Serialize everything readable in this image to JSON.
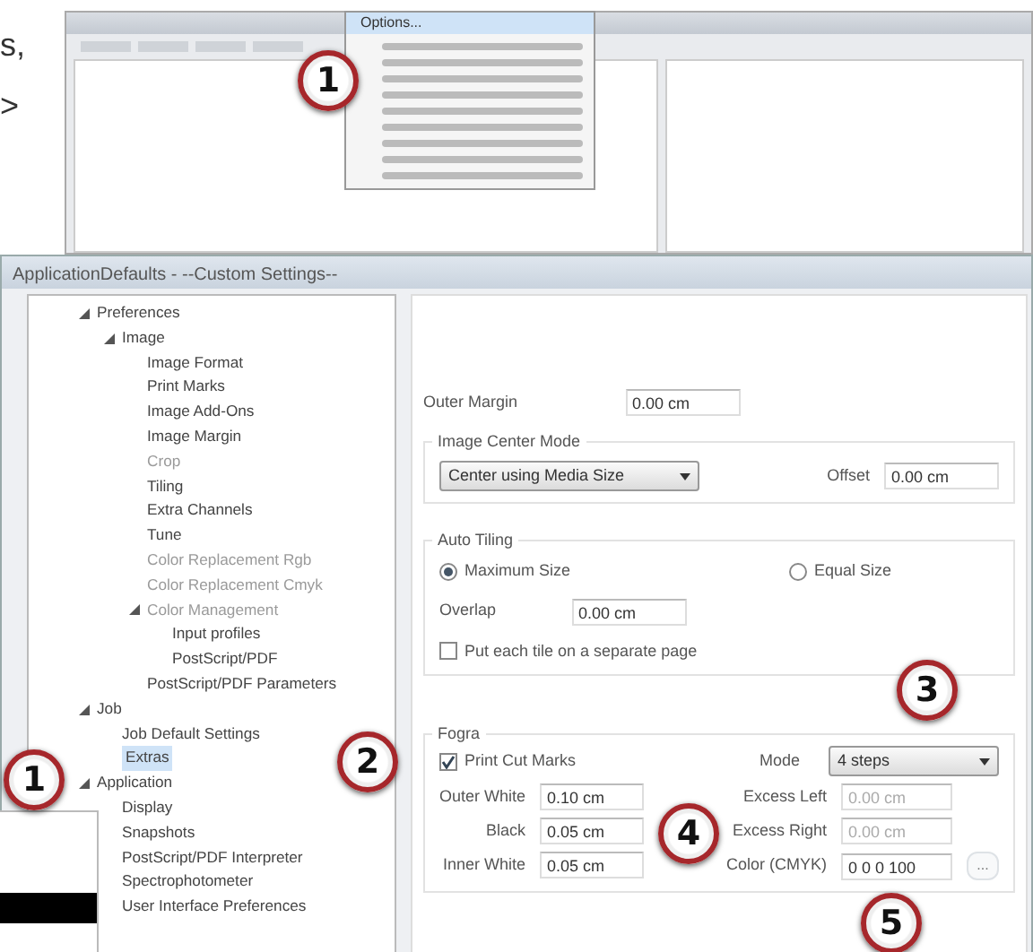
{
  "page_fragments": [
    "s,",
    ">"
  ],
  "background_window": {
    "menu": {
      "first_item": "Options..."
    },
    "callout": "1"
  },
  "dialog": {
    "title": "ApplicationDefaults - --Custom Settings--",
    "tree": [
      {
        "label": "Preferences",
        "expanded": true,
        "selected": false,
        "disabled": false,
        "children": [
          {
            "label": "Image",
            "expanded": true,
            "selected": false,
            "disabled": false,
            "children": [
              {
                "label": "Image Format",
                "selected": false,
                "disabled": false
              },
              {
                "label": "Print Marks",
                "selected": false,
                "disabled": false
              },
              {
                "label": "Image Add-Ons",
                "selected": false,
                "disabled": false
              },
              {
                "label": "Image Margin",
                "selected": false,
                "disabled": false
              },
              {
                "label": "Crop",
                "selected": false,
                "disabled": true
              },
              {
                "label": "Tiling",
                "selected": false,
                "disabled": false
              },
              {
                "label": "Extra Channels",
                "selected": false,
                "disabled": false
              },
              {
                "label": "Tune",
                "selected": false,
                "disabled": false
              },
              {
                "label": "Color Replacement Rgb",
                "selected": false,
                "disabled": true
              },
              {
                "label": "Color Replacement Cmyk",
                "selected": false,
                "disabled": true
              },
              {
                "label": "Color Management",
                "expanded": true,
                "selected": false,
                "disabled": true,
                "children": [
                  {
                    "label": "Input profiles",
                    "selected": false,
                    "disabled": false
                  },
                  {
                    "label": "PostScript/PDF",
                    "selected": false,
                    "disabled": false
                  }
                ]
              },
              {
                "label": "PostScript/PDF Parameters",
                "selected": false,
                "disabled": false
              }
            ]
          }
        ]
      },
      {
        "label": "Job",
        "expanded": true,
        "selected": false,
        "disabled": false,
        "children": [
          {
            "label": "Job Default Settings",
            "selected": false,
            "disabled": false
          },
          {
            "label": "Extras",
            "selected": true,
            "disabled": false
          }
        ]
      },
      {
        "label": "Application",
        "expanded": true,
        "selected": false,
        "disabled": false,
        "children": [
          {
            "label": "Display",
            "selected": false,
            "disabled": false
          },
          {
            "label": "Snapshots",
            "selected": false,
            "disabled": false
          },
          {
            "label": "PostScript/PDF Interpreter",
            "selected": false,
            "disabled": false
          },
          {
            "label": "Spectrophotometer",
            "selected": false,
            "disabled": false
          },
          {
            "label": "User Interface Preferences",
            "selected": false,
            "disabled": false
          }
        ]
      }
    ],
    "outer_margin": {
      "label": "Outer Margin",
      "value": "0.00 cm"
    },
    "image_center_mode": {
      "title": "Image Center Mode",
      "select": "Center using Media Size",
      "offset_label": "Offset",
      "offset": "0.00 cm"
    },
    "auto_tiling": {
      "title": "Auto Tiling",
      "options": [
        {
          "label": "Maximum Size",
          "selected": true
        },
        {
          "label": "Equal Size",
          "selected": false
        }
      ],
      "overlap_label": "Overlap",
      "overlap": "0.00 cm",
      "separate_page": {
        "label": "Put each tile on a separate page",
        "checked": false
      }
    },
    "fogra": {
      "title": "Fogra",
      "print_marks": {
        "label": "Print Cut Marks",
        "checked": true
      },
      "mode_label": "Mode",
      "mode": "4 steps",
      "left_fields": [
        {
          "label": "Outer White",
          "value": "0.10 cm"
        },
        {
          "label": "Black",
          "value": "0.05 cm"
        },
        {
          "label": "Inner White",
          "value": "0.05 cm"
        }
      ],
      "right_fields": [
        {
          "label": "Excess Left",
          "value": "0.00 cm",
          "disabled": true
        },
        {
          "label": "Excess Right",
          "value": "0.00 cm",
          "disabled": true
        },
        {
          "label": "Color (CMYK)",
          "value": "0 0 0 100",
          "disabled": false
        }
      ],
      "color_button": "..."
    }
  },
  "callouts": [
    "1",
    "2",
    "3",
    "4",
    "5"
  ]
}
